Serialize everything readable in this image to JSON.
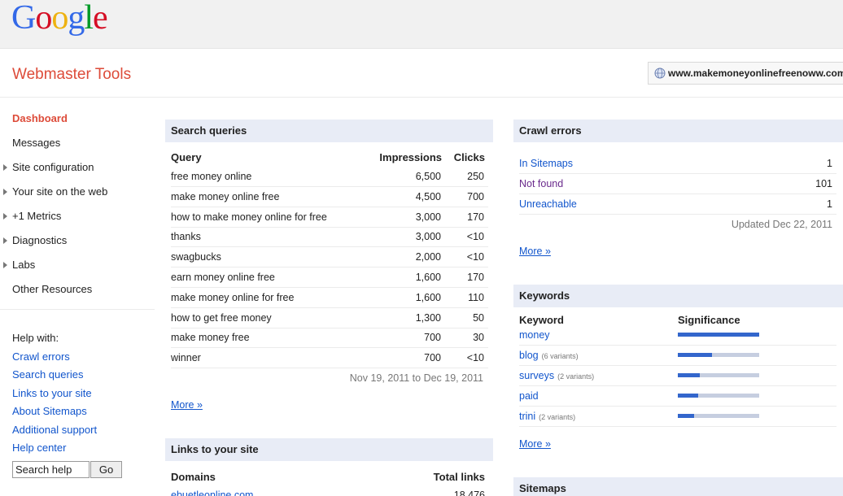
{
  "logo": {
    "letters": [
      "G",
      "o",
      "o",
      "g",
      "l",
      "e"
    ],
    "colors": [
      "#3369e8",
      "#d50f25",
      "#eeb211",
      "#3369e8",
      "#009925",
      "#d50f25"
    ]
  },
  "header": {
    "product_name": "Webmaster Tools",
    "site_url": "www.makemoneyonlinefreenoww.com"
  },
  "sidebar": {
    "items": [
      {
        "label": "Dashboard"
      },
      {
        "label": "Messages"
      },
      {
        "label": "Site configuration"
      },
      {
        "label": "Your site on the web"
      },
      {
        "label": "+1 Metrics"
      },
      {
        "label": "Diagnostics"
      },
      {
        "label": "Labs"
      },
      {
        "label": "Other Resources"
      }
    ],
    "help_title": "Help with:",
    "help_links": [
      {
        "label": "Crawl errors"
      },
      {
        "label": "Search queries"
      },
      {
        "label": "Links to your site"
      },
      {
        "label": "About Sitemaps"
      },
      {
        "label": "Additional support"
      },
      {
        "label": "Help center"
      }
    ],
    "search_value": "Search help",
    "go_label": "Go"
  },
  "search_queries": {
    "title": "Search queries",
    "headers": {
      "query": "Query",
      "impressions": "Impressions",
      "clicks": "Clicks"
    },
    "rows": [
      {
        "query": "free money online",
        "impressions": "6,500",
        "clicks": "250"
      },
      {
        "query": "make money online free",
        "impressions": "4,500",
        "clicks": "700"
      },
      {
        "query": "how to make money online for free",
        "impressions": "3,000",
        "clicks": "170"
      },
      {
        "query": "thanks",
        "impressions": "3,000",
        "clicks": "<10"
      },
      {
        "query": "swagbucks",
        "impressions": "2,000",
        "clicks": "<10"
      },
      {
        "query": "earn money online free",
        "impressions": "1,600",
        "clicks": "170"
      },
      {
        "query": "make money online for free",
        "impressions": "1,600",
        "clicks": "110"
      },
      {
        "query": "how to get free money",
        "impressions": "1,300",
        "clicks": "50"
      },
      {
        "query": "make money free",
        "impressions": "700",
        "clicks": "30"
      },
      {
        "query": "winner",
        "impressions": "700",
        "clicks": "<10"
      }
    ],
    "date_range": "Nov 19, 2011 to Dec 19, 2011",
    "more_label": "More »"
  },
  "links": {
    "title": "Links to your site",
    "headers": {
      "domains": "Domains",
      "total": "Total links"
    },
    "rows": [
      {
        "domain": "ebuetleonline.com",
        "total": "18,476"
      }
    ]
  },
  "crawl_errors": {
    "title": "Crawl errors",
    "rows": [
      {
        "label": "In Sitemaps",
        "value": "1"
      },
      {
        "label": "Not found",
        "value": "101"
      },
      {
        "label": "Unreachable",
        "value": "1"
      }
    ],
    "updated": "Updated Dec 22, 2011",
    "more_label": "More »"
  },
  "keywords": {
    "title": "Keywords",
    "headers": {
      "keyword": "Keyword",
      "significance": "Significance"
    },
    "rows": [
      {
        "keyword": "money",
        "variants": "",
        "significance": 1.0
      },
      {
        "keyword": "blog",
        "variants": "(6 variants)",
        "significance": 0.42
      },
      {
        "keyword": "surveys",
        "variants": "(2 variants)",
        "significance": 0.27
      },
      {
        "keyword": "paid",
        "variants": "",
        "significance": 0.25
      },
      {
        "keyword": "trini",
        "variants": "(2 variants)",
        "significance": 0.2
      }
    ],
    "more_label": "More »"
  },
  "sitemaps": {
    "title": "Sitemaps"
  }
}
